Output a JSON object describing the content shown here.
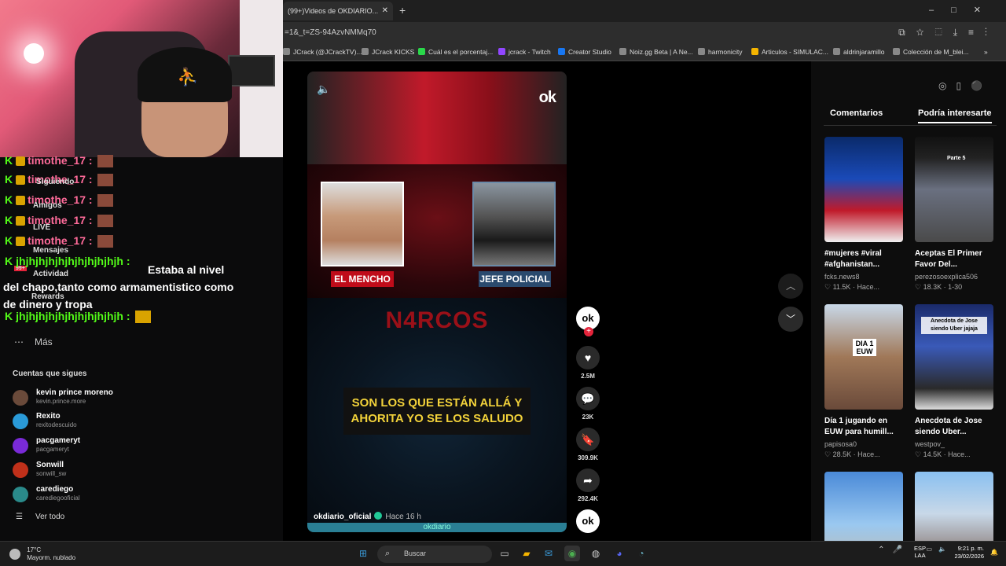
{
  "browser": {
    "tab_title": "(99+)Videos de OKDIARIO...",
    "address": "=1&_t=ZS-94AzvNMMq70",
    "bookmarks": [
      "JCrack (@JCrackTV)...",
      "JCrack KICKS",
      "Cuál es el porcentaj...",
      "jcrack - Twitch",
      "Creator Studio",
      "Noiz.gg Beta | A Ne...",
      "harmonicity",
      "Articulos - SIMULAC...",
      "aldrinjaramillo",
      "Colección de M_blei..."
    ]
  },
  "chat": {
    "repeat_user": "timothe_17 :",
    "lines_user": "jhjhjhjhjhjhjhjhjhjhjh :",
    "long_message": "Estaba al nivel del chapo,tanto como armamentistico como de dinero y tropa",
    "ghost_labels": [
      "Siguiendo",
      "Amigos",
      "LIVE",
      "Mensajes",
      "Actividad",
      "Rewards"
    ],
    "ghost_counter": "99+"
  },
  "sidebar": {
    "more_label": "Más",
    "following_title": "Cuentas que sigues",
    "following": [
      {
        "name": "kevin prince moreno",
        "sub": "kevin.prince.more",
        "color": "#6a4a3a"
      },
      {
        "name": "Rexito",
        "sub": "rexitodescuido",
        "color": "#2a9ad8"
      },
      {
        "name": "pacgameryt",
        "sub": "pacgameryt",
        "color": "#7a2ad8"
      },
      {
        "name": "Sonwill",
        "sub": "sonwill_sw",
        "color": "#c0301a"
      },
      {
        "name": "carediego",
        "sub": "carediegooficial",
        "color": "#2a8a8a"
      }
    ],
    "see_all": "Ver todo"
  },
  "video": {
    "logo": "ok",
    "label_left": "EL MENCHO",
    "label_right": "JEFE POLICIAL",
    "title_graphic": "N4RCOS",
    "subtitle": "SON LOS QUE ESTÁN ALLÁ Y AHORITA YO SE LOS SALUDO",
    "author": "okdiario_oficial",
    "time": "Hace 16 h",
    "watermark": "okdiario"
  },
  "actions": {
    "likes": "2.5M",
    "comments": "23K",
    "saves": "309.9K",
    "shares": "292.4K"
  },
  "panel": {
    "tab_comments": "Comentarios",
    "tab_suggested": "Podría interesarte",
    "cards": [
      {
        "title": "#mujeres #viral #afghanistan...",
        "user": "fcks.news8",
        "likes": "11.5K",
        "time": "Hace...",
        "bg": "linear-gradient(180deg,#0a2a6a 0%,#1a4ab8 40%,#c01a2a 70%,#f0f0f0 100%)",
        "tag": ""
      },
      {
        "title": "Aceptas El Primer Favor Del...",
        "user": "perezosoexplica506",
        "likes": "18.3K",
        "time": "1-30",
        "bg": "linear-gradient(180deg,#111 0%,#222 20%,#6a7080 50%,#4a4a4a 100%)",
        "tag": "Parte 5"
      },
      {
        "title": "Día 1 jugando en EUW para humill...",
        "user": "papisosa0",
        "likes": "28.5K",
        "time": "Hace...",
        "bg": "linear-gradient(180deg,#c8d8e8 0%,#a07858 50%,#6a4a3a 100%)",
        "tag": "DIA 1 EUW"
      },
      {
        "title": "Anecdota de Jose siendo Uber...",
        "user": "westpov_",
        "likes": "14.5K",
        "time": "Hace...",
        "bg": "linear-gradient(180deg,#1a2a6a 0%,#3a5ab8 40%,#2a2a2a 80%,#ddd 100%)",
        "tag": "Anecdota de Jose siendo Uber jajaja"
      },
      {
        "title": "",
        "user": "",
        "likes": "",
        "time": "",
        "bg": "linear-gradient(180deg,#4a8ad8 0%,#9ac8f0 50%,#c8b8a0 100%)",
        "tag": ""
      },
      {
        "title": "",
        "user": "",
        "likes": "",
        "time": "",
        "bg": "linear-gradient(180deg,#8ac0f0 0%,#c8d8e8 40%,#6a4a3a 100%)",
        "tag": ""
      }
    ]
  },
  "taskbar": {
    "temp": "17°C",
    "weather": "Mayorm. nublado",
    "search": "Buscar",
    "lang1": "ESP",
    "lang2": "LAA",
    "time": "9:21 p. m.",
    "date": "23/02/2026"
  }
}
